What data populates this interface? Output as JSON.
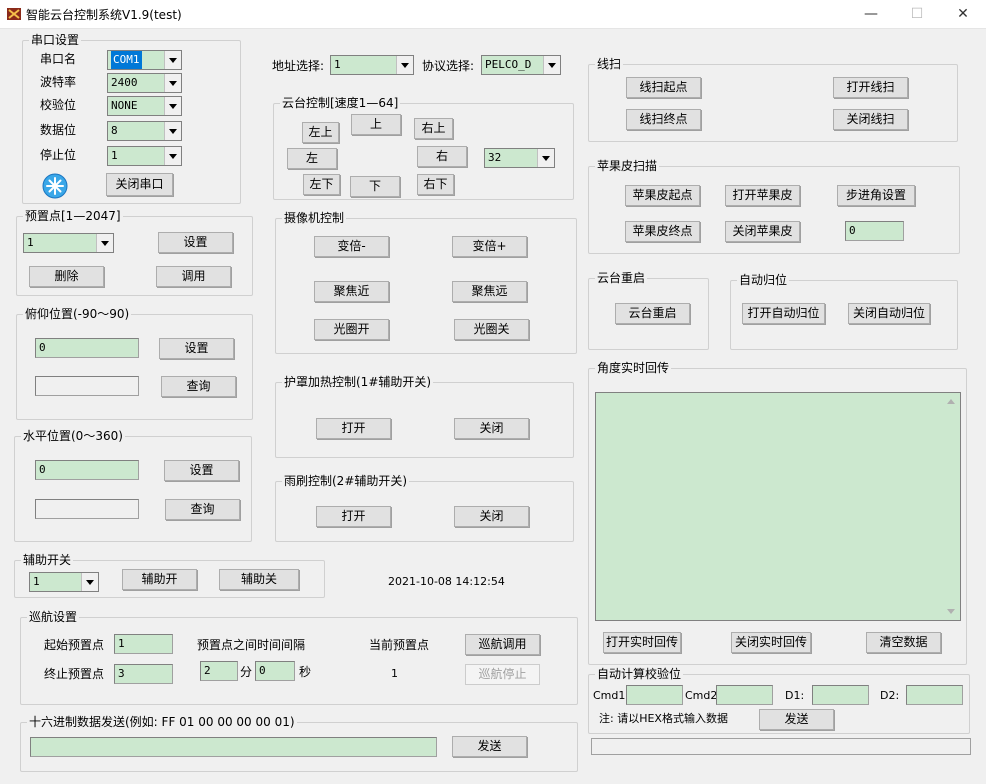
{
  "window": {
    "title": "智能云台控制系统V1.9(test)",
    "min": "—",
    "max": "☐",
    "close": "✕"
  },
  "serial": {
    "title": "串口设置",
    "port_label": "串口名",
    "port_value": "COM1",
    "baud_label": "波特率",
    "baud_value": "2400",
    "parity_label": "校验位",
    "parity_value": "NONE",
    "databits_label": "数据位",
    "databits_value": "8",
    "stopbits_label": "停止位",
    "stopbits_value": "1",
    "close_btn": "关闭串口"
  },
  "address": {
    "label": "地址选择:",
    "value": "1"
  },
  "protocol": {
    "label": "协议选择:",
    "value": "PELCO_D"
  },
  "ptz": {
    "title": "云台控制[速度1—64]",
    "up_left": "左上",
    "up": "上",
    "up_right": "右上",
    "left": "左",
    "right": "右",
    "speed_value": "32",
    "down_left": "左下",
    "down": "下",
    "down_right": "右下"
  },
  "preset": {
    "title": "预置点[1—2047]",
    "value": "1",
    "set": "设置",
    "delete": "删除",
    "call": "调用"
  },
  "tilt": {
    "title": "俯仰位置(-90～90)",
    "value": "0",
    "query_value": "",
    "set": "设置",
    "query": "查询"
  },
  "pan": {
    "title": "水平位置(0～360)",
    "value": "0",
    "query_value": "",
    "set": "设置",
    "query": "查询"
  },
  "camera": {
    "title": "摄像机控制",
    "zoom_out": "变倍-",
    "zoom_in": "变倍+",
    "focus_near": "聚焦近",
    "focus_far": "聚焦远",
    "iris_open": "光圈开",
    "iris_close": "光圈关"
  },
  "heater": {
    "title": "护罩加热控制(1#辅助开关)",
    "open": "打开",
    "close": "关闭"
  },
  "wiper": {
    "title": "雨刷控制(2#辅助开关)",
    "open": "打开",
    "close": "关闭"
  },
  "aux": {
    "title": "辅助开关",
    "value": "1",
    "on": "辅助开",
    "off": "辅助关"
  },
  "datetime": "2021-10-08 14:12:54",
  "cruise": {
    "title": "巡航设置",
    "start_label": "起始预置点",
    "start_value": "1",
    "end_label": "终止预置点",
    "end_value": "3",
    "interval_label": "预置点之间时间间隔",
    "min_value": "2",
    "min_unit": "分",
    "sec_value": "0",
    "sec_unit": "秒",
    "current_label": "当前预置点",
    "current_value": "1",
    "call": "巡航调用",
    "stop": "巡航停止"
  },
  "hex": {
    "title": "十六进制数据发送(例如: FF 01 00 00 00 00 01)",
    "value": "",
    "send": "发送"
  },
  "linescan": {
    "title": "线扫",
    "start": "线扫起点",
    "end": "线扫终点",
    "open": "打开线扫",
    "close": "关闭线扫"
  },
  "apple": {
    "title": "苹果皮扫描",
    "start": "苹果皮起点",
    "end": "苹果皮终点",
    "open": "打开苹果皮",
    "close": "关闭苹果皮",
    "step": "步进角设置",
    "step_value": "0"
  },
  "reboot": {
    "title": "云台重启",
    "btn": "云台重启"
  },
  "autohome": {
    "title": "自动归位",
    "open": "打开自动归位",
    "close": "关闭自动归位"
  },
  "angle": {
    "title": "角度实时回传",
    "open": "打开实时回传",
    "close": "关闭实时回传",
    "clear": "清空数据"
  },
  "checksum": {
    "title": "自动计算校验位",
    "cmd1_label": "Cmd1:",
    "cmd2_label": "Cmd2:",
    "d1_label": "D1:",
    "d2_label": "D2:",
    "cmd1": "",
    "cmd2": "",
    "d1": "",
    "d2": "",
    "note": "注: 请以HEX格式输入数据",
    "send": "发送"
  },
  "colors": {
    "field_bg": "#cce8cf",
    "selection": "#0078d7"
  }
}
